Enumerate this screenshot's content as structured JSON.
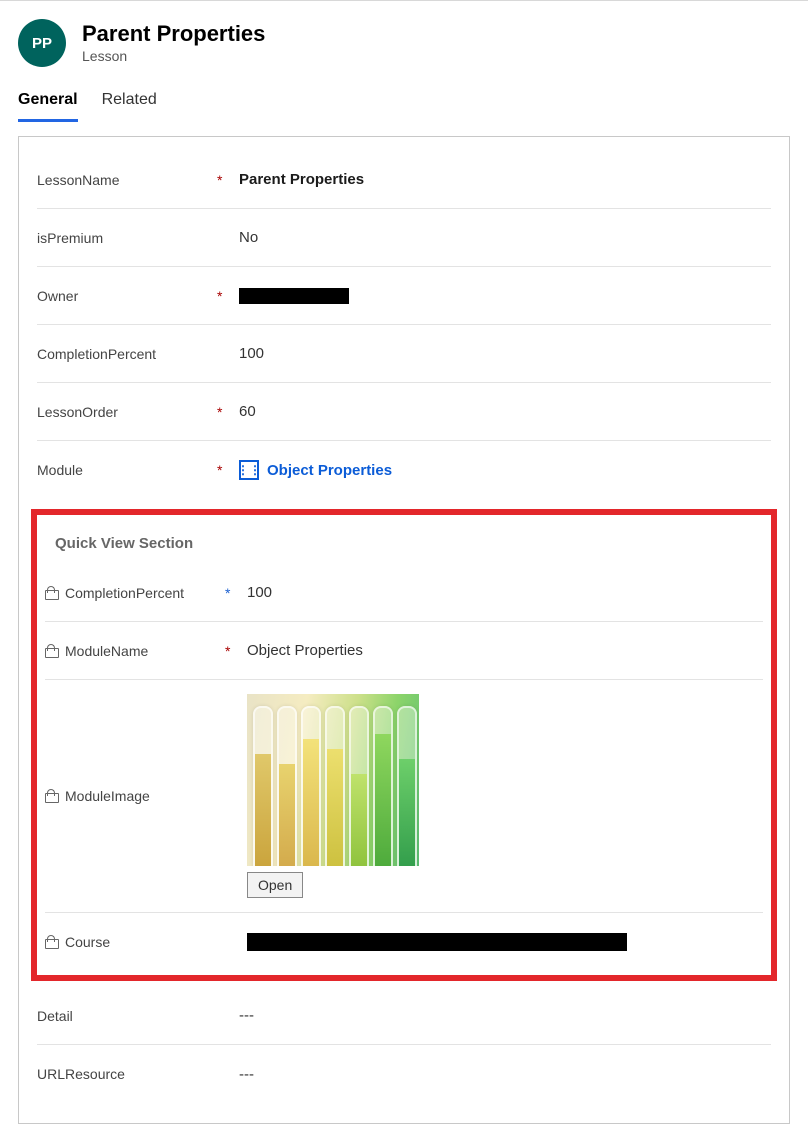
{
  "header": {
    "avatar_initials": "PP",
    "title": "Parent Properties",
    "subtitle": "Lesson"
  },
  "tabs": {
    "active": "General",
    "general": "General",
    "related": "Related"
  },
  "fields": {
    "lessonName": {
      "label": "LessonName",
      "required": "*",
      "value": "Parent Properties"
    },
    "isPremium": {
      "label": "isPremium",
      "required": "",
      "value": "No"
    },
    "owner": {
      "label": "Owner",
      "required": "*"
    },
    "completionPercent": {
      "label": "CompletionPercent",
      "required": "",
      "value": "100"
    },
    "lessonOrder": {
      "label": "LessonOrder",
      "required": "*",
      "value": "60"
    },
    "module": {
      "label": "Module",
      "required": "*",
      "value": "Object Properties"
    },
    "detail": {
      "label": "Detail",
      "value": "---"
    },
    "urlResource": {
      "label": "URLResource",
      "value": "---"
    }
  },
  "quickView": {
    "title": "Quick View Section",
    "completionPercent": {
      "label": "CompletionPercent",
      "required": "*",
      "value": "100"
    },
    "moduleName": {
      "label": "ModuleName",
      "required": "*",
      "value": "Object Properties"
    },
    "moduleImage": {
      "label": "ModuleImage",
      "openLabel": "Open"
    },
    "course": {
      "label": "Course"
    }
  }
}
